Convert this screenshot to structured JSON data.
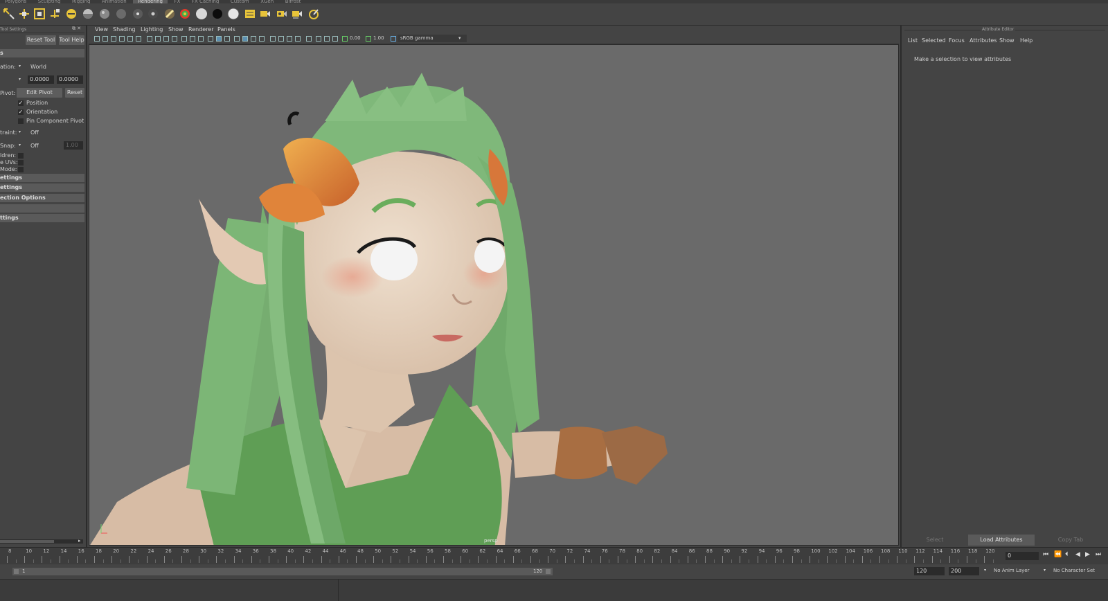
{
  "shelf_tabs": [
    "Polygons",
    "Sculpting",
    "Rigging",
    "Animation",
    "Rendering",
    "FX",
    "FX Caching",
    "Custom",
    "XGen",
    "Bifrost"
  ],
  "active_shelf": "Rendering",
  "tool_settings": {
    "title": "Tool Settings",
    "reset_tool": "Reset Tool",
    "tool_help": "Tool Help",
    "orientation_label": "ation:",
    "orientation_value": "World",
    "value_a": "0.0000",
    "value_b": "0.0000",
    "pivot_label": "Pivot:",
    "edit_pivot": "Edit Pivot",
    "reset": "Reset",
    "position": "Position",
    "orientation_chk": "Orientation",
    "pin_component_pivot": "Pin Component Pivot",
    "constraint_label": "traint:",
    "constraint_value": "Off",
    "snap_label": "Snap:",
    "snap_value": "Off",
    "snap_amount": "1.00",
    "children_label": "ldren:",
    "uvs_label": "e UVs:",
    "mode_label": "Mode:",
    "sections": [
      "ettings",
      "ettings",
      "ection Options",
      "",
      "ttings"
    ]
  },
  "viewport": {
    "menus": [
      "View",
      "Shading",
      "Lighting",
      "Show",
      "Renderer",
      "Panels"
    ],
    "exposure": "0.00",
    "gamma": "1.00",
    "color_space": "sRGB gamma",
    "camera_label": "persp"
  },
  "attribute_editor": {
    "title": "Attribute Editor",
    "tabs": [
      "List",
      "Selected",
      "Focus",
      "Attributes",
      "Show",
      "Help"
    ],
    "message": "Make a selection to view attributes",
    "select_btn": "Select",
    "load_btn": "Load Attributes",
    "copy_btn": "Copy Tab"
  },
  "timeline": {
    "tick_labels": [
      "8",
      "10",
      "12",
      "14",
      "16",
      "18",
      "20",
      "22",
      "24",
      "26",
      "28",
      "30",
      "32",
      "34",
      "36",
      "38",
      "40",
      "42",
      "44",
      "46",
      "48",
      "50",
      "52",
      "54",
      "56",
      "58",
      "60",
      "62",
      "64",
      "66",
      "68",
      "70",
      "72",
      "74",
      "76",
      "78",
      "80",
      "82",
      "84",
      "86",
      "88",
      "90",
      "92",
      "94",
      "96",
      "98",
      "100",
      "102",
      "104",
      "106",
      "108",
      "110",
      "112",
      "114",
      "116",
      "118",
      "120"
    ],
    "current_frame": "0"
  },
  "range": {
    "start": "1",
    "end_slider": "120",
    "end": "120",
    "max": "200",
    "anim_layer": "No Anim Layer",
    "character_set": "No Character Set"
  },
  "colors": {
    "panel": "#444444",
    "viewport_bg": "#6a6a6a",
    "hair": "#7fb87a",
    "leaf": "#e0843a",
    "skin": "#e9d7c5"
  }
}
